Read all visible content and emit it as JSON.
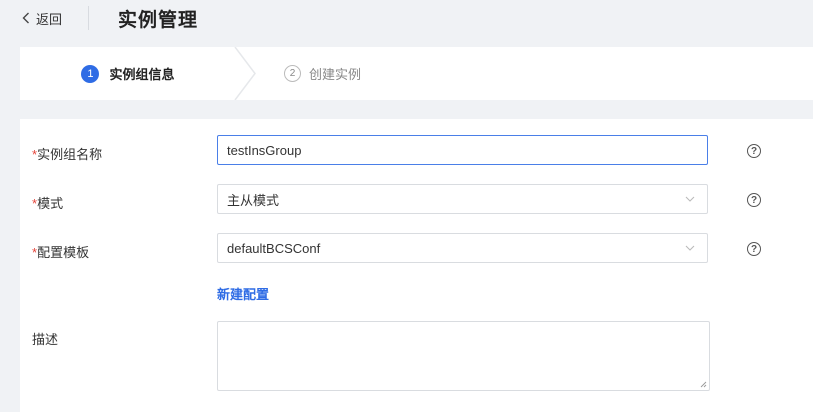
{
  "header": {
    "back_label": "返回",
    "title": "实例管理"
  },
  "steps": [
    {
      "number": "1",
      "label": "实例组信息",
      "active": true
    },
    {
      "number": "2",
      "label": "创建实例",
      "active": false
    }
  ],
  "form": {
    "required_mark": "*",
    "fields": {
      "group_name": {
        "label": "实例组名称",
        "value": "testInsGroup",
        "required": true
      },
      "mode": {
        "label": "模式",
        "value": "主从模式",
        "required": true
      },
      "config_template": {
        "label": "配置模板",
        "value": "defaultBCSConf",
        "required": true
      },
      "description": {
        "label": "描述",
        "value": "",
        "required": false
      }
    },
    "new_config_link": "新建配置",
    "help_glyph": "?"
  },
  "colors": {
    "accent": "#2f6ce5",
    "required": "#e5443a",
    "background": "#f0f2f5"
  },
  "icons": {
    "back": "chevron-left-icon",
    "select": "chevron-down-icon",
    "help": "question-circle-icon"
  }
}
